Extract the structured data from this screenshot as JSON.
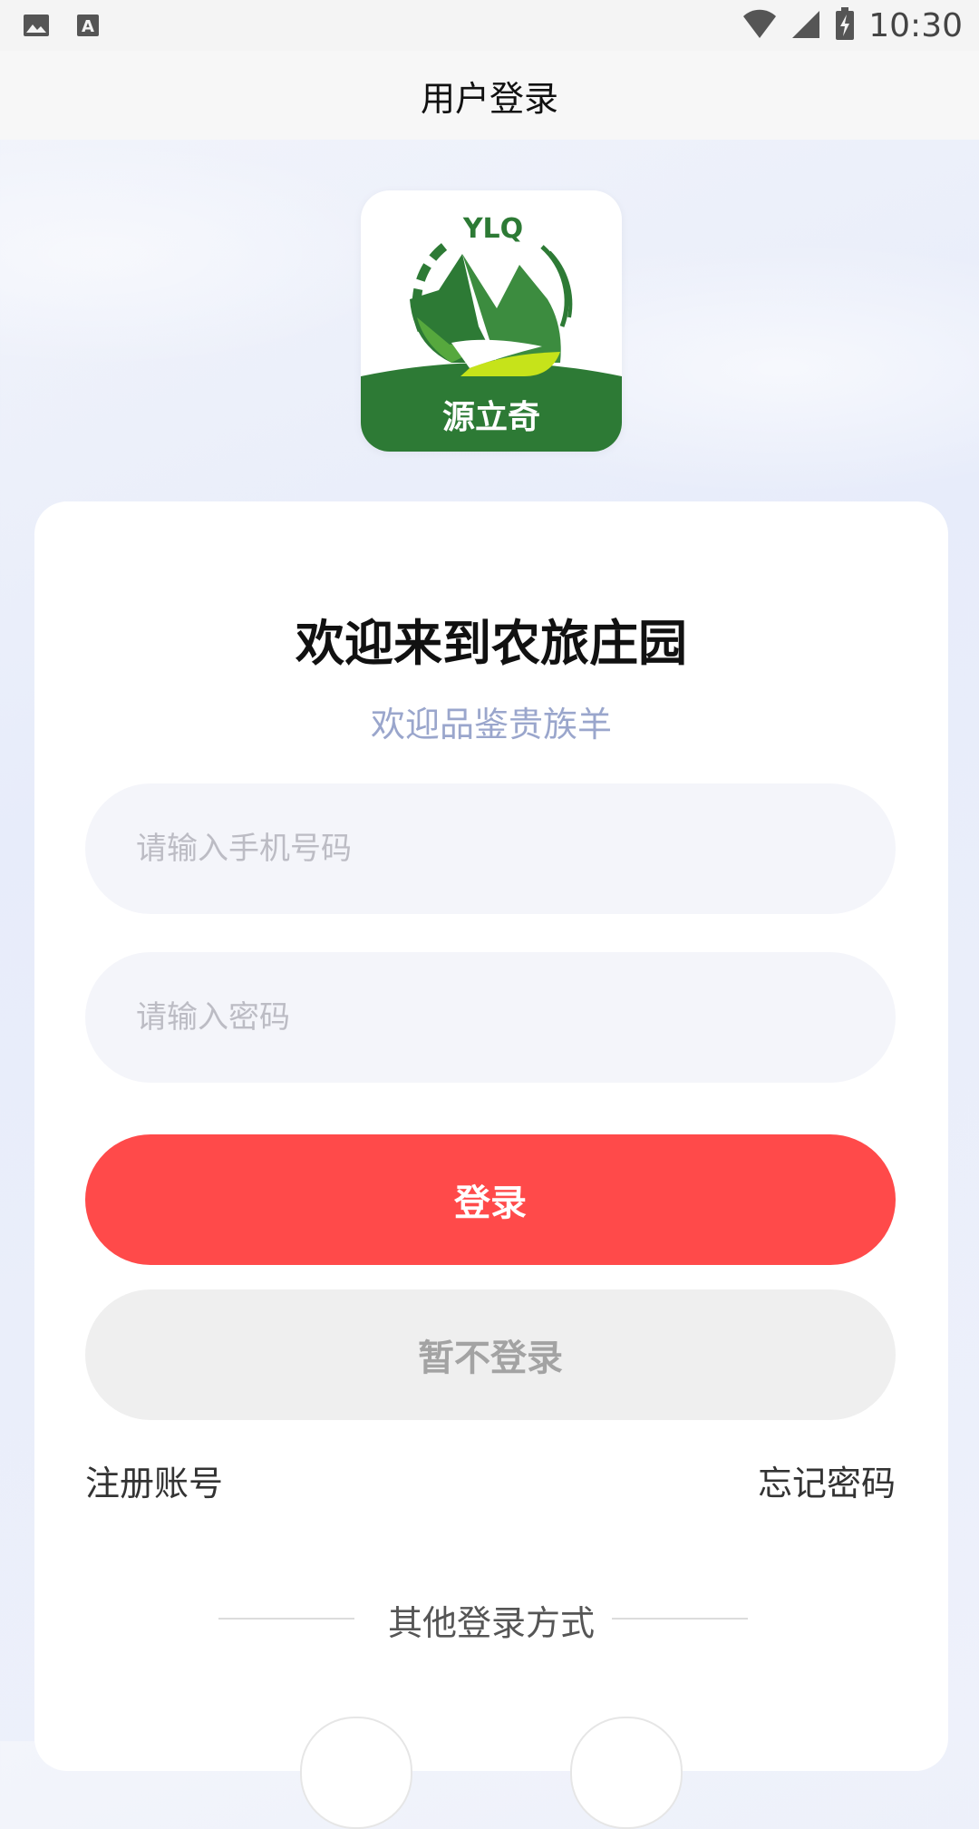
{
  "status_bar": {
    "time": "10:30",
    "icons": [
      "image-icon",
      "text-a-icon",
      "wifi-icon",
      "cell-signal-icon",
      "battery-charging-icon"
    ]
  },
  "header": {
    "title": "用户登录"
  },
  "logo": {
    "brand_text": "源立奇",
    "letters": "YLQ",
    "colors": {
      "green": "#2d7a35",
      "light_green": "#c6e31a"
    }
  },
  "card": {
    "welcome_title": "欢迎来到农旅庄园",
    "subtitle": "欢迎品鉴贵族羊",
    "phone_placeholder": "请输入手机号码",
    "password_placeholder": "请输入密码",
    "login_label": "登录",
    "skip_label": "暂不登录",
    "register_label": "注册账号",
    "forgot_label": "忘记密码",
    "other_login_label": "其他登录方式"
  },
  "colors": {
    "login_button": "#ff4a4a",
    "skip_button": "#efefef",
    "subtitle": "#9aa6cc"
  }
}
